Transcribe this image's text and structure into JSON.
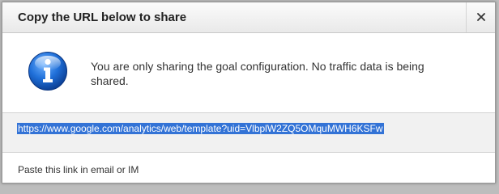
{
  "dialog": {
    "title": "Copy the URL below to share",
    "close_label": "×"
  },
  "info": {
    "icon": "info-icon",
    "message": "You are only sharing the goal configuration. No traffic data is being shared."
  },
  "share": {
    "url": "https://www.google.com/analytics/web/template?uid=VlbplW2ZQ5OMquMWH6KSFw",
    "instruction": "Paste this link in email or IM"
  },
  "colors": {
    "selection": "#3373d6",
    "icon_blue": "#1f5fc0"
  }
}
